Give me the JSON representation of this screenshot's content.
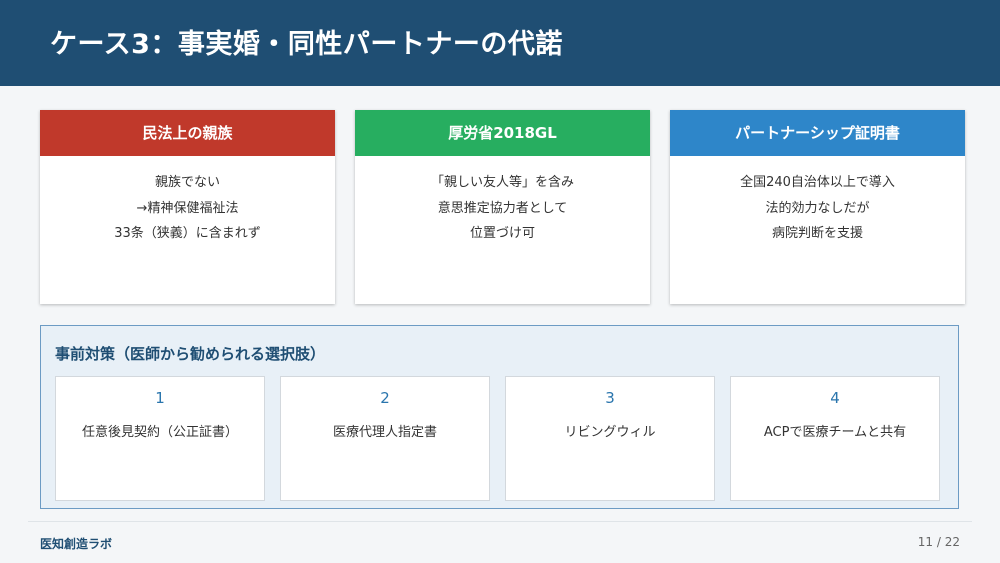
{
  "title": "ケース3：事実婚・同性パートナーの代諾",
  "cards": [
    {
      "heading": "民法上の親族",
      "color": "#c0392b",
      "lines": [
        "親族でない",
        "→精神保健福祉法",
        "33条（狭義）に含まれず"
      ]
    },
    {
      "heading": "厚労省2018GL",
      "color": "#27ae60",
      "lines": [
        "「親しい友人等」を含み",
        "意思推定協力者として",
        "位置づけ可"
      ]
    },
    {
      "heading": "パートナーシップ証明書",
      "color": "#2e86c9",
      "lines": [
        "全国240自治体以上で導入",
        "法的効力なしだが",
        "病院判断を支援"
      ]
    }
  ],
  "measures": {
    "title": "事前対策（医師から勧められる選択肢）",
    "items": [
      {
        "num": "1",
        "label": "任意後見契約（公正証書）"
      },
      {
        "num": "2",
        "label": "医療代理人指定書"
      },
      {
        "num": "3",
        "label": "リビングウィル"
      },
      {
        "num": "4",
        "label": "ACPで医療チームと共有"
      }
    ]
  },
  "footer": {
    "brand": "医知創造ラボ",
    "page": "11 / 22"
  }
}
